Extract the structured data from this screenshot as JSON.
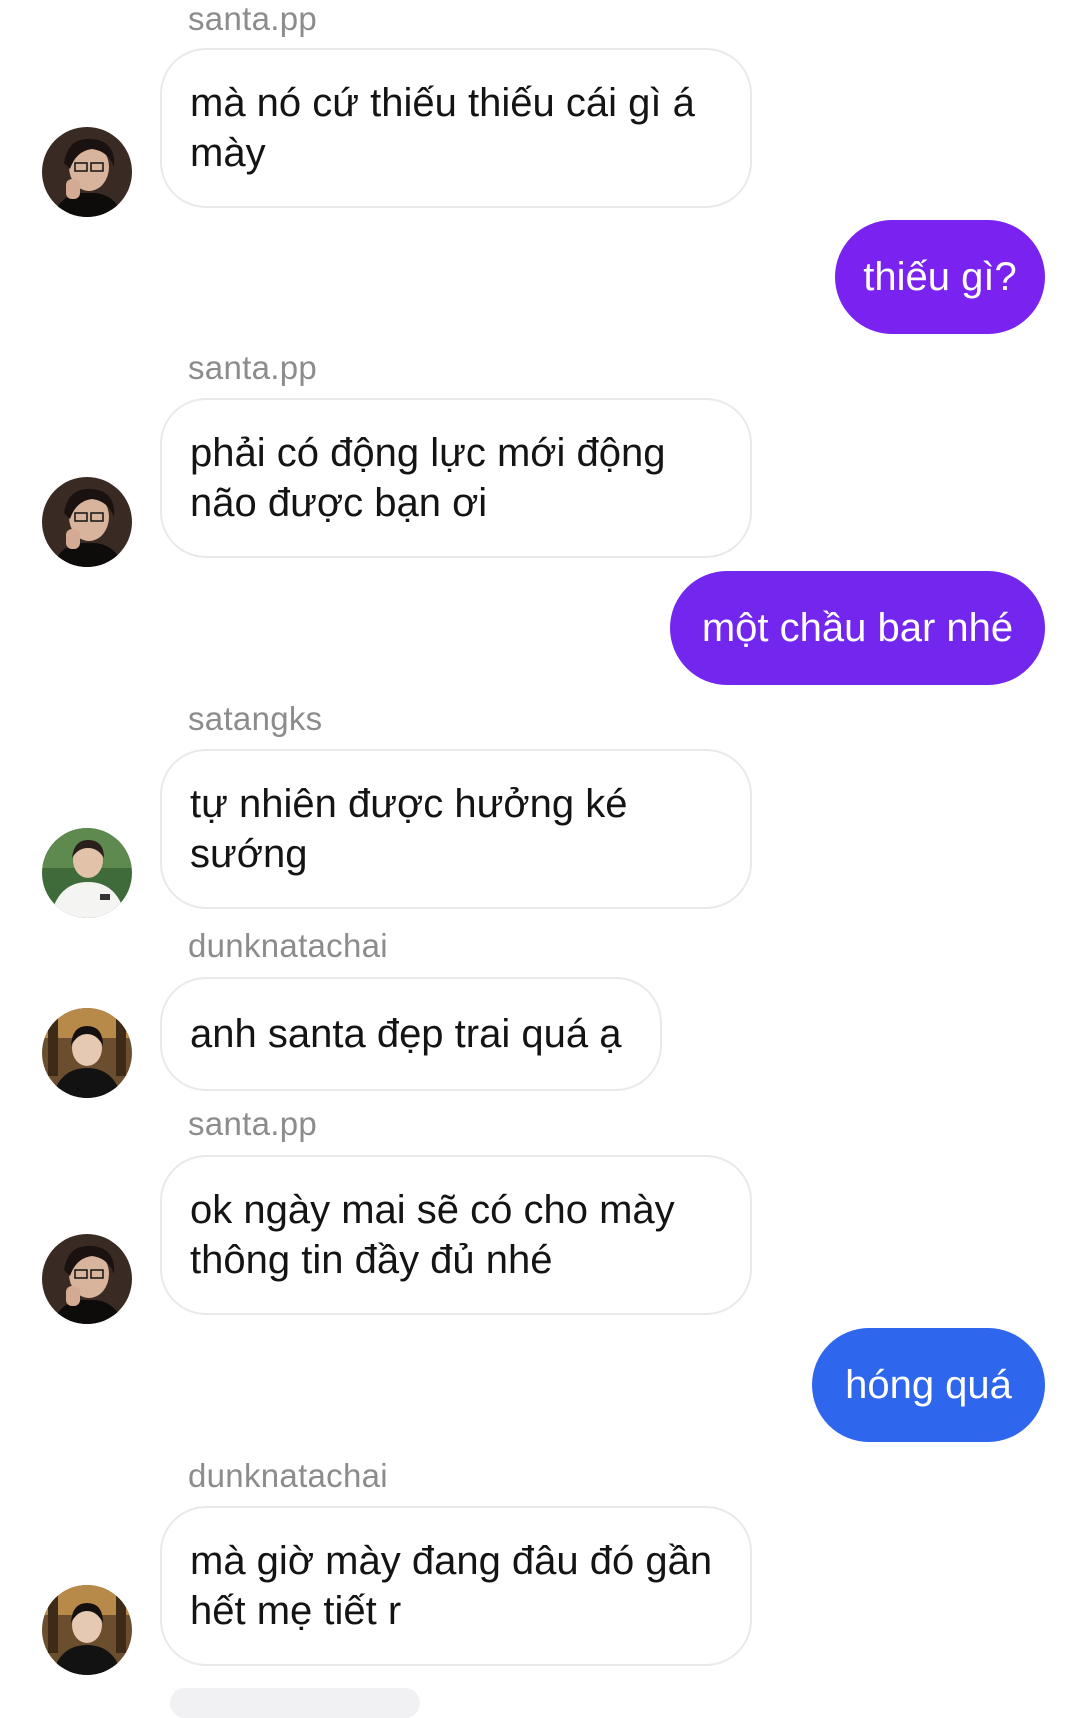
{
  "chat": {
    "messages": [
      {
        "type": "incoming",
        "sender": "santa.pp",
        "text": "mà nó cứ thiếu thiếu cái gì á mày",
        "avatar": "avatar-santa"
      },
      {
        "type": "outgoing",
        "text": "thiếu gì?",
        "color": "#7a22f0"
      },
      {
        "type": "incoming",
        "sender": "santa.pp",
        "text": "phải có động lực mới động não được bạn ơi",
        "avatar": "avatar-santa"
      },
      {
        "type": "outgoing",
        "text": "một chầu bar nhé",
        "color": "#7326ee"
      },
      {
        "type": "incoming",
        "sender": "satangks",
        "text": "tự nhiên được hưởng ké sướng",
        "avatar": "avatar-satang"
      },
      {
        "type": "incoming",
        "sender": "dunknatachai",
        "text": "anh santa đẹp trai quá ạ",
        "avatar": "avatar-dunk"
      },
      {
        "type": "incoming",
        "sender": "santa.pp",
        "text": "ok ngày mai sẽ có cho mày thông tin đầy đủ nhé",
        "avatar": "avatar-santa"
      },
      {
        "type": "outgoing",
        "text": "hóng quá",
        "color": "#2f66ee"
      },
      {
        "type": "incoming",
        "sender": "dunknatachai",
        "text": "mà giờ mày đang đâu đó gần hết mẹ tiết r",
        "avatar": "avatar-dunk"
      }
    ]
  },
  "colors": {
    "incoming_bubble": "#ffffff",
    "incoming_border": "#e9e9ec",
    "sender_name": "#8c8c8c",
    "text": "#141414"
  }
}
